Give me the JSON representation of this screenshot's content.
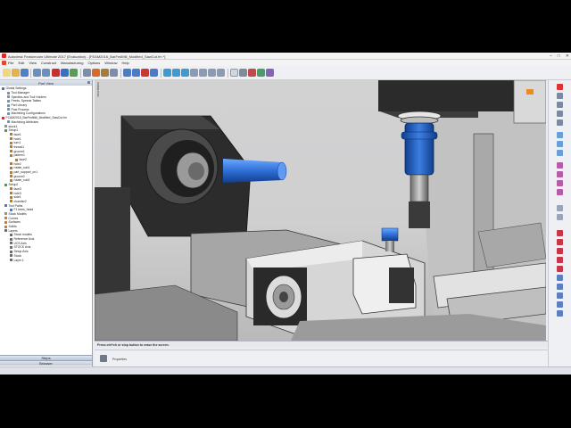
{
  "window": {
    "title": "Autodesk Featurecam Ultimate 2017 (Evaluation) - [FEAM2016_BarFedMill_Modified_SawCut.fm *]",
    "controls": [
      "–",
      "□",
      "✕"
    ]
  },
  "menu": [
    "File",
    "Edit",
    "View",
    "Construct",
    "Manufacturing",
    "Options",
    "Window",
    "Help"
  ],
  "left_panel": {
    "header": "Part View",
    "tree": [
      {
        "label": "Global Settings",
        "indent": 0,
        "color": "#5a6f8e"
      },
      {
        "label": "Tool Manager",
        "indent": 2,
        "color": "#7d8fa8"
      },
      {
        "label": "Spindles and Tool Holders",
        "indent": 2,
        "color": "#7d8fa8"
      },
      {
        "label": "Feeds, Speeds Tables",
        "indent": 2,
        "color": "#7d8fa8"
      },
      {
        "label": "Part Library",
        "indent": 2,
        "color": "#7d8fa8"
      },
      {
        "label": "Post Process",
        "indent": 2,
        "color": "#7d8fa8"
      },
      {
        "label": "Machining Configurations",
        "indent": 2,
        "color": "#7d8fa8"
      },
      {
        "label": "FCAM2016_BarFedMill_Modified_SawCut.fm",
        "indent": 0,
        "color": "#d8282a",
        "selected": false
      },
      {
        "label": "Machining Attributes",
        "indent": 2,
        "color": "#7d8fa8"
      },
      {
        "label": "stock1",
        "indent": 1,
        "color": "#8f8f8f"
      },
      {
        "label": "Setup1",
        "indent": 1,
        "color": "#4b9a49"
      },
      {
        "label": "face1",
        "indent": 3,
        "color": "#b07b2a"
      },
      {
        "label": "hole1",
        "indent": 3,
        "color": "#b07b2a"
      },
      {
        "label": "turn1",
        "indent": 3,
        "color": "#b07b2a"
      },
      {
        "label": "thread1",
        "indent": 3,
        "color": "#b07b2a"
      },
      {
        "label": "groove1",
        "indent": 3,
        "color": "#b07b2a"
      },
      {
        "label": "pattern1",
        "indent": 3,
        "color": "#b07b2a"
      },
      {
        "label": "face2",
        "indent": 5,
        "color": "#b07b2a"
      },
      {
        "label": "hole2",
        "indent": 3,
        "color": "#b07b2a"
      },
      {
        "label": "rotate_sub1",
        "indent": 3,
        "color": "#b07b2a"
      },
      {
        "label": "part_support_on1",
        "indent": 3,
        "color": "#b07b2a"
      },
      {
        "label": "groove2",
        "indent": 3,
        "color": "#b07b2a"
      },
      {
        "label": "rotate_sub2",
        "indent": 3,
        "color": "#b07b2a"
      },
      {
        "label": "Setup2",
        "indent": 1,
        "color": "#4b9a49"
      },
      {
        "label": "face3",
        "indent": 3,
        "color": "#b07b2a"
      },
      {
        "label": "hole3",
        "indent": 3,
        "color": "#b07b2a"
      },
      {
        "label": "side1",
        "indent": 3,
        "color": "#b07b2a"
      },
      {
        "label": "chamfer2",
        "indent": 3,
        "color": "#b07b2a"
      },
      {
        "label": "Tool Paths",
        "indent": 1,
        "color": "#3a7bd5"
      },
      {
        "label": "F1 bees_head",
        "indent": 3,
        "color": "#3a7bd5"
      },
      {
        "label": "Stock Models",
        "indent": 1,
        "color": "#8f8f8f"
      },
      {
        "label": "Curves",
        "indent": 1,
        "color": "#d07a2a"
      },
      {
        "label": "Surfaces",
        "indent": 1,
        "color": "#d07a2a"
      },
      {
        "label": "Solids",
        "indent": 1,
        "color": "#d07a2a"
      },
      {
        "label": "Layers",
        "indent": 1,
        "color": "#6a6a6a"
      },
      {
        "label": "Stock models",
        "indent": 3,
        "color": "#6a6a6a"
      },
      {
        "label": "Reference Axis",
        "indent": 3,
        "color": "#6a6a6a"
      },
      {
        "label": "UCS Axis",
        "indent": 3,
        "color": "#6a6a6a"
      },
      {
        "label": "STOCK Axis",
        "indent": 3,
        "color": "#6a6a6a"
      },
      {
        "label": "Setup Axis",
        "indent": 3,
        "color": "#6a6a6a"
      },
      {
        "label": "Stock",
        "indent": 3,
        "color": "#6a6a6a"
      },
      {
        "label": "Layer 1",
        "indent": 3,
        "color": "#6a6a6a"
      }
    ],
    "tabs": [
      "Steps",
      "Browser"
    ]
  },
  "viewport": {
    "orientation_label": "ISOMETRIC"
  },
  "prompt": {
    "text": "Press ctrl+ch or stop button to erase the screen."
  },
  "properties": {
    "label": "Properties"
  },
  "colors": {
    "accent": "#3a7bd5",
    "tool_blue": "#1f5fc2",
    "brand_red": "#d8282a"
  }
}
